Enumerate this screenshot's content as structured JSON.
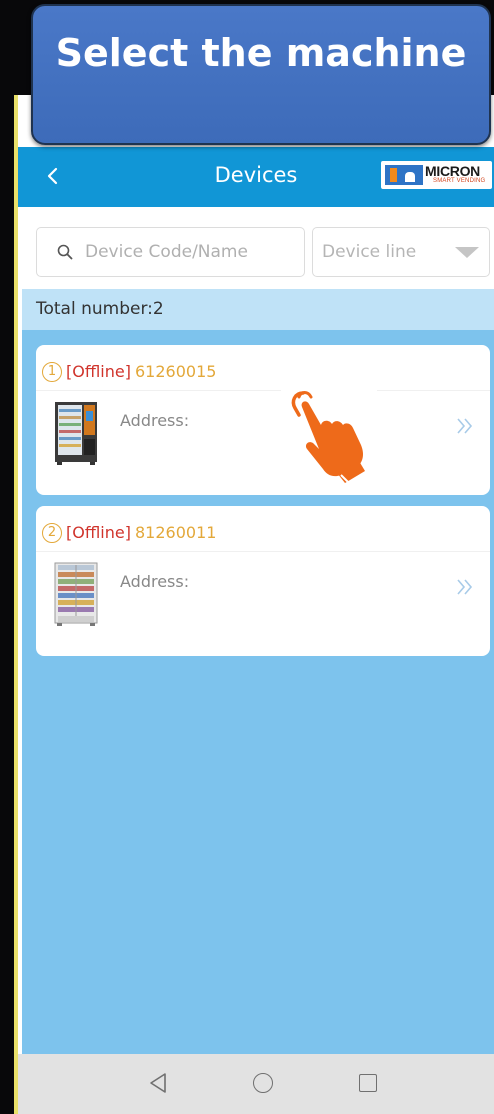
{
  "banner": {
    "title": "Select the machine"
  },
  "header": {
    "back_icon": "chevron-left-icon",
    "title": "Devices"
  },
  "logo": {
    "brand": "MICRON",
    "tagline": "SMART VENDING",
    "mark_color": "#2e74c6",
    "accent": "#f28a1c"
  },
  "search": {
    "placeholder": "Device Code/Name",
    "icon": "search-icon"
  },
  "device_line": {
    "label": "Device line",
    "icon": "triangle-down-icon"
  },
  "summary": {
    "total_label": "Total number:2"
  },
  "devices": [
    {
      "index": "1",
      "status": "[Offline]",
      "code": "61260015",
      "address_label": "Address:"
    },
    {
      "index": "2",
      "status": "[Offline]",
      "code": "81260011",
      "address_label": "Address:"
    }
  ],
  "nav": {
    "back": "nav-back-icon",
    "home": "nav-home-icon",
    "recent": "nav-recent-icon"
  },
  "colors": {
    "header": "#1196d6",
    "content_bg": "#7dc3ed",
    "status_offline": "#d0342c",
    "code": "#e3a83a",
    "banner": "#4a78c8",
    "pointer_hand": "#ee6a1a"
  }
}
